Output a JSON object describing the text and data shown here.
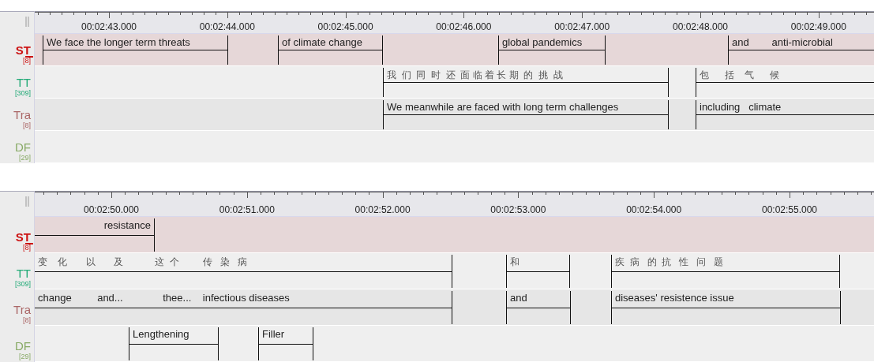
{
  "panels": [
    {
      "ruler": {
        "labels": [
          "00:02:43.000",
          "00:02:44.000",
          "00:02:45.000",
          "00:02:46.000",
          "00:02:47.000",
          "00:02:48.000",
          "00:02:49.000"
        ]
      },
      "tiers": [
        {
          "name": "ST",
          "count": "[8]",
          "color": "#cc1111",
          "selected": true,
          "annotations": [
            {
              "text": "We face the longer term threats"
            },
            {
              "text": "of climate change"
            },
            {
              "text": "global pandemics"
            },
            {
              "text": "and        anti-microbial"
            }
          ]
        },
        {
          "name": "TT",
          "count": "[309]",
          "color": "#22aa77",
          "selected": false,
          "annotations": [
            {
              "text": "我  们  同  时  还  面 临 着 长 期  的  挑  战"
            },
            {
              "text": "包      括    气      候"
            }
          ]
        },
        {
          "name": "Tra",
          "count": "[8]",
          "color": "#aa6666",
          "selected": false,
          "annotations": [
            {
              "text": "We meanwhile are faced with long term challenges"
            },
            {
              "text": "including   climate"
            }
          ]
        },
        {
          "name": "DF",
          "count": "[29]",
          "color": "#88aa66",
          "selected": false
        }
      ]
    },
    {
      "ruler": {
        "labels": [
          "00:02:50.000",
          "00:02:51.000",
          "00:02:52.000",
          "00:02:53.000",
          "00:02:54.000",
          "00:02:55.000"
        ]
      },
      "tiers": [
        {
          "name": "ST",
          "count": "[8]",
          "color": "#cc1111",
          "selected": true,
          "annotations": [
            {
              "text": "resistance"
            }
          ]
        },
        {
          "name": "TT",
          "count": "[309]",
          "color": "#22aa77",
          "selected": false,
          "annotations": [
            {
              "text": "变    化       以       及            这  个         传   染   病"
            },
            {
              "text": "和"
            },
            {
              "text": "疾  病   的  抗   性   问   题"
            }
          ]
        },
        {
          "name": "Tra",
          "count": "[8]",
          "color": "#aa6666",
          "selected": false,
          "annotations": [
            {
              "text": "change         and...              thee...    infectious diseases"
            },
            {
              "text": "and"
            },
            {
              "text": "diseases' resistence issue"
            }
          ]
        },
        {
          "name": "DF",
          "count": "[29]",
          "color": "#88aa66",
          "selected": false,
          "annotations": [
            {
              "text": "Lengthening"
            },
            {
              "text": "Filler"
            }
          ]
        }
      ]
    }
  ]
}
